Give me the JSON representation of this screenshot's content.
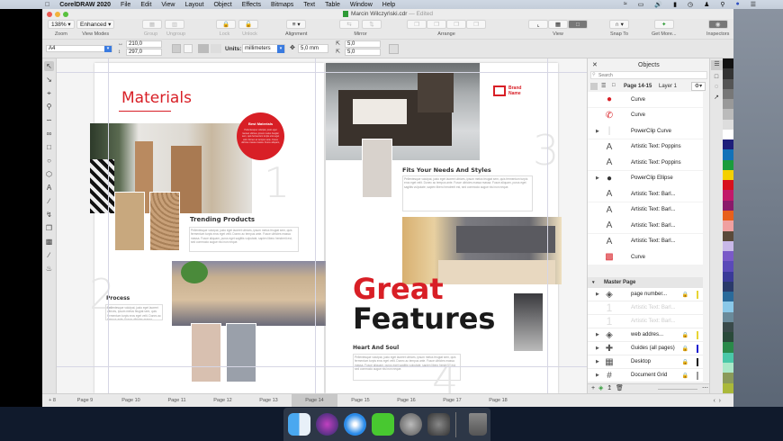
{
  "menubar": {
    "app": "CorelDRAW 2020",
    "items": [
      "File",
      "Edit",
      "View",
      "Layout",
      "Object",
      "Effects",
      "Bitmaps",
      "Text",
      "Table",
      "Window",
      "Help"
    ],
    "status_icons": [
      "wifi-icon",
      "airplay-icon",
      "volume-icon",
      "battery-icon",
      "clock-icon",
      "user-icon",
      "search-icon",
      "siri-icon",
      "menu-icon"
    ]
  },
  "window": {
    "title": "Marcin Wilczyński.cdr",
    "subtitle": "— Edited"
  },
  "toolbar": {
    "zoom_value": "138%",
    "zoom_label": "Zoom",
    "view_mode_value": "Enhanced",
    "view_mode_label": "View Modes",
    "group": "Group",
    "ungroup": "Ungroup",
    "lock": "Lock",
    "unlock": "Unlock",
    "alignment": "Alignment",
    "mirror": "Mirror",
    "arrange": "Arrange",
    "view": "View",
    "snap_to": "Snap To",
    "get_more": "Get More...",
    "inspectors": "Inspectors"
  },
  "propbar": {
    "page_size": "A4",
    "width": "210,0",
    "height": "297,0",
    "units_label": "Units:",
    "units_value": "millimeters",
    "nudge": "5,0 mm",
    "dup_x": "5,0",
    "dup_y": "5,0"
  },
  "tools": [
    "pick-tool",
    "shape-tool",
    "crop-tool",
    "zoom-tool",
    "freehand-tool",
    "artistic-media-tool",
    "rectangle-tool",
    "ellipse-tool",
    "polygon-tool",
    "text-tool",
    "parallel-dimension-tool",
    "connector-tool",
    "drop-shadow-tool",
    "transparency-tool",
    "eyedropper-tool",
    "fill-tool"
  ],
  "document": {
    "materials_title": "Materials",
    "best_materials": "Best Materials",
    "trending_products": "Trending Products",
    "process": "Process",
    "fits_title": "Fits Your Needs And Styles",
    "brand_name_1": "Brand",
    "brand_name_2": "Name",
    "great": "Great",
    "features": "Features",
    "heart_and_soul": "Heart And Soul",
    "page_numbers": [
      "1",
      "2",
      "3",
      "4"
    ],
    "lorem": "Pellentesque volutpat, justo eget laoreet ultrices, ipsum metus feugiat sem, quis fermentum turpis eros eget velit. Donec ac tempus ante. Fusce ultricies massa massa. Fusce aliquam, purus eget sagittis vulputate, sapien libero hendrerit est, sed commodo augue nisi non neque."
  },
  "objects_panel": {
    "title": "Objects",
    "search_placeholder": "Search",
    "page": "Page 14-15",
    "layer": "Layer 1",
    "items": [
      {
        "label": "Curve",
        "icon": "curve-red-icon"
      },
      {
        "label": "Curve",
        "icon": "phone-icon"
      },
      {
        "label": "PowerClip Curve",
        "icon": "powerclip-icon",
        "expand": true
      },
      {
        "label": "Artistic Text: Poppins",
        "icon": "text-icon"
      },
      {
        "label": "Artistic Text: Poppins",
        "icon": "text-icon"
      },
      {
        "label": "PowerClip Ellipse",
        "icon": "ellipse-icon",
        "expand": true
      },
      {
        "label": "Artistic Text: Barl...",
        "icon": "text-icon"
      },
      {
        "label": "Artistic Text: Barl...",
        "icon": "text-icon"
      },
      {
        "label": "Artistic Text: Barl...",
        "icon": "text-icon"
      },
      {
        "label": "Artistic Text: Barl...",
        "icon": "text-icon"
      },
      {
        "label": "Curve",
        "icon": "logo-icon"
      }
    ],
    "master_page": "Master Page",
    "master_items": [
      {
        "label": "page number...",
        "color": "#e8d534"
      },
      {
        "label": "Artistic Text: Barl...",
        "dim": true
      },
      {
        "label": "Artistic Text: Barl...",
        "dim": true
      },
      {
        "label": "web addres...",
        "color": "#e8d534"
      },
      {
        "label": "Guides (all pages)",
        "color": "#1a1ad0"
      },
      {
        "label": "Desktop",
        "color": "#111111"
      },
      {
        "label": "Document Grid",
        "color": "#999999"
      }
    ]
  },
  "page_tabs": {
    "first": "8",
    "tabs": [
      "Page 9",
      "Page 10",
      "Page 11",
      "Page 12",
      "Page 13",
      "Page 14",
      "Page 15",
      "Page 16",
      "Page 17",
      "Page 18"
    ],
    "active": "Page 14"
  },
  "palette": [
    "#111111",
    "#333333",
    "#555555",
    "#777777",
    "#999999",
    "#bbbbbb",
    "#dddddd",
    "#ffffff",
    "#1e1e7a",
    "#1272b8",
    "#1a9c3c",
    "#f4d000",
    "#d8101c",
    "#c2186a",
    "#8a1a6a",
    "#e8601c",
    "#f0a0a0",
    "#5a4a3a",
    "#c8b8e8",
    "#7a5ac8",
    "#5a4ab8",
    "#3a3a98",
    "#2a3a6a",
    "#2a6a9a",
    "#8ac8e8",
    "#6a8a9a",
    "#3a4a4a",
    "#2a4a3a",
    "#2a8a4a",
    "#4ac8a8",
    "#aae8c8",
    "#8a9a5a",
    "#aab83a"
  ],
  "colors": {
    "accent_red": "#d81f26",
    "dark": "#1a1a1a"
  },
  "dock": [
    "finder-icon",
    "siri-icon",
    "safari-icon",
    "coreldraw-icon",
    "launchpad-icon",
    "system-preferences-icon",
    "trash-icon"
  ]
}
